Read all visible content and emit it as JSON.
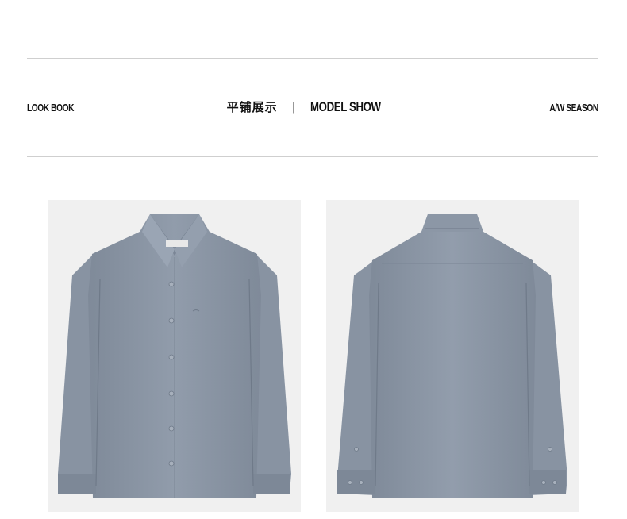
{
  "header": {
    "left_label": "LOOK BOOK",
    "center_cn": "平铺展示",
    "center_separator": "|",
    "center_en": "MODEL SHOW",
    "right_label": "A/W SEASON"
  },
  "images": {
    "front": {
      "subject": "shirt-front"
    },
    "back": {
      "subject": "shirt-back"
    }
  },
  "colors": {
    "shirt": "#8e99a8",
    "panel_bg": "#f0f0f0",
    "rule": "#cfcfcf"
  }
}
